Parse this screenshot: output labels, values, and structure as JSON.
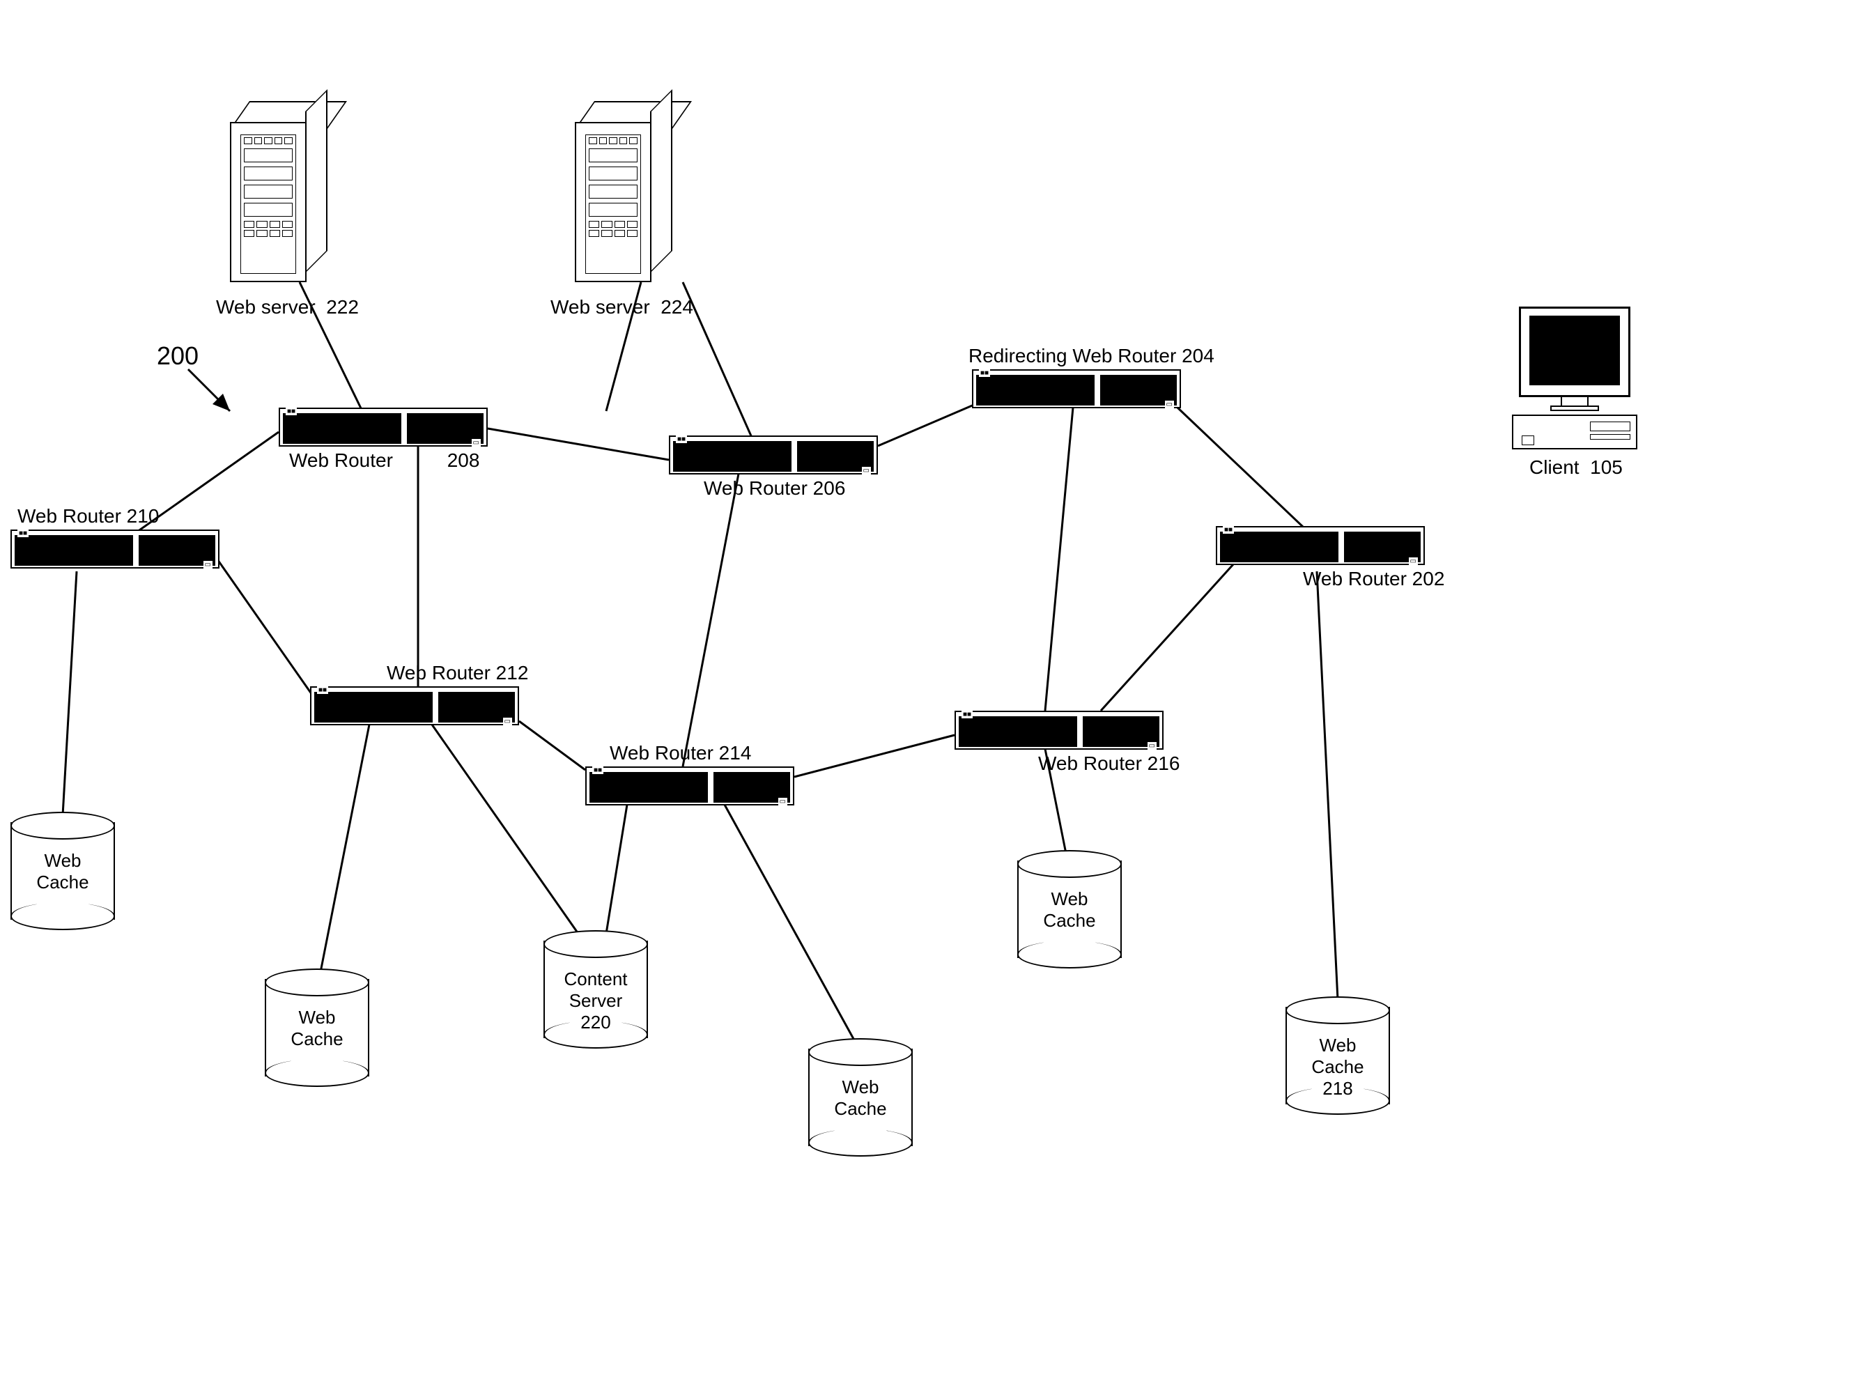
{
  "figureRef": "200",
  "client": {
    "label": "Client",
    "ref": "105"
  },
  "servers": {
    "s1": {
      "label": "Web server",
      "ref": "222"
    },
    "s2": {
      "label": "Web server",
      "ref": "224"
    }
  },
  "routers": {
    "r202": {
      "label": "Web Router",
      "ref": "202"
    },
    "r204": {
      "label": "Redirecting Web Router",
      "ref": "204"
    },
    "r206": {
      "label": "Web Router",
      "ref": "206"
    },
    "r208": {
      "label": "Web Router",
      "ref": "208"
    },
    "r210": {
      "label": "Web Router",
      "ref": "210"
    },
    "r212": {
      "label": "Web Router",
      "ref": "212"
    },
    "r214": {
      "label": "Web Router",
      "ref": "214"
    },
    "r216": {
      "label": "Web Router",
      "ref": "216"
    }
  },
  "storage": {
    "cache1": {
      "label": "Web\nCache"
    },
    "cache2": {
      "label": "Web\nCache"
    },
    "cache3": {
      "label": "Web\nCache"
    },
    "cache4": {
      "label": "Web\nCache"
    },
    "cache218": {
      "label": "Web\nCache",
      "ref": "218"
    },
    "content220": {
      "label": "Content\nServer",
      "ref": "220"
    }
  }
}
